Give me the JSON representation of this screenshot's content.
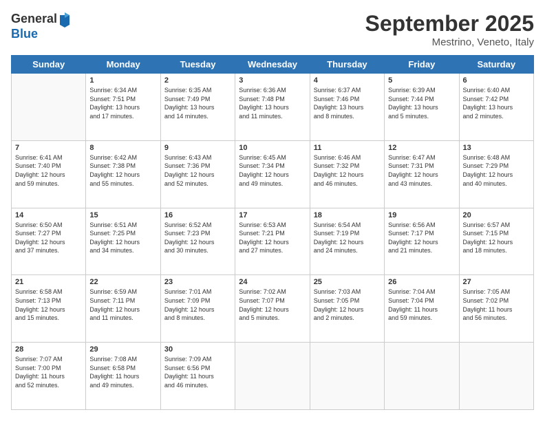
{
  "logo": {
    "general": "General",
    "blue": "Blue"
  },
  "header": {
    "month": "September 2025",
    "location": "Mestrino, Veneto, Italy"
  },
  "days_of_week": [
    "Sunday",
    "Monday",
    "Tuesday",
    "Wednesday",
    "Thursday",
    "Friday",
    "Saturday"
  ],
  "weeks": [
    [
      {
        "day": "",
        "content": ""
      },
      {
        "day": "1",
        "content": "Sunrise: 6:34 AM\nSunset: 7:51 PM\nDaylight: 13 hours\nand 17 minutes."
      },
      {
        "day": "2",
        "content": "Sunrise: 6:35 AM\nSunset: 7:49 PM\nDaylight: 13 hours\nand 14 minutes."
      },
      {
        "day": "3",
        "content": "Sunrise: 6:36 AM\nSunset: 7:48 PM\nDaylight: 13 hours\nand 11 minutes."
      },
      {
        "day": "4",
        "content": "Sunrise: 6:37 AM\nSunset: 7:46 PM\nDaylight: 13 hours\nand 8 minutes."
      },
      {
        "day": "5",
        "content": "Sunrise: 6:39 AM\nSunset: 7:44 PM\nDaylight: 13 hours\nand 5 minutes."
      },
      {
        "day": "6",
        "content": "Sunrise: 6:40 AM\nSunset: 7:42 PM\nDaylight: 13 hours\nand 2 minutes."
      }
    ],
    [
      {
        "day": "7",
        "content": "Sunrise: 6:41 AM\nSunset: 7:40 PM\nDaylight: 12 hours\nand 59 minutes."
      },
      {
        "day": "8",
        "content": "Sunrise: 6:42 AM\nSunset: 7:38 PM\nDaylight: 12 hours\nand 55 minutes."
      },
      {
        "day": "9",
        "content": "Sunrise: 6:43 AM\nSunset: 7:36 PM\nDaylight: 12 hours\nand 52 minutes."
      },
      {
        "day": "10",
        "content": "Sunrise: 6:45 AM\nSunset: 7:34 PM\nDaylight: 12 hours\nand 49 minutes."
      },
      {
        "day": "11",
        "content": "Sunrise: 6:46 AM\nSunset: 7:32 PM\nDaylight: 12 hours\nand 46 minutes."
      },
      {
        "day": "12",
        "content": "Sunrise: 6:47 AM\nSunset: 7:31 PM\nDaylight: 12 hours\nand 43 minutes."
      },
      {
        "day": "13",
        "content": "Sunrise: 6:48 AM\nSunset: 7:29 PM\nDaylight: 12 hours\nand 40 minutes."
      }
    ],
    [
      {
        "day": "14",
        "content": "Sunrise: 6:50 AM\nSunset: 7:27 PM\nDaylight: 12 hours\nand 37 minutes."
      },
      {
        "day": "15",
        "content": "Sunrise: 6:51 AM\nSunset: 7:25 PM\nDaylight: 12 hours\nand 34 minutes."
      },
      {
        "day": "16",
        "content": "Sunrise: 6:52 AM\nSunset: 7:23 PM\nDaylight: 12 hours\nand 30 minutes."
      },
      {
        "day": "17",
        "content": "Sunrise: 6:53 AM\nSunset: 7:21 PM\nDaylight: 12 hours\nand 27 minutes."
      },
      {
        "day": "18",
        "content": "Sunrise: 6:54 AM\nSunset: 7:19 PM\nDaylight: 12 hours\nand 24 minutes."
      },
      {
        "day": "19",
        "content": "Sunrise: 6:56 AM\nSunset: 7:17 PM\nDaylight: 12 hours\nand 21 minutes."
      },
      {
        "day": "20",
        "content": "Sunrise: 6:57 AM\nSunset: 7:15 PM\nDaylight: 12 hours\nand 18 minutes."
      }
    ],
    [
      {
        "day": "21",
        "content": "Sunrise: 6:58 AM\nSunset: 7:13 PM\nDaylight: 12 hours\nand 15 minutes."
      },
      {
        "day": "22",
        "content": "Sunrise: 6:59 AM\nSunset: 7:11 PM\nDaylight: 12 hours\nand 11 minutes."
      },
      {
        "day": "23",
        "content": "Sunrise: 7:01 AM\nSunset: 7:09 PM\nDaylight: 12 hours\nand 8 minutes."
      },
      {
        "day": "24",
        "content": "Sunrise: 7:02 AM\nSunset: 7:07 PM\nDaylight: 12 hours\nand 5 minutes."
      },
      {
        "day": "25",
        "content": "Sunrise: 7:03 AM\nSunset: 7:05 PM\nDaylight: 12 hours\nand 2 minutes."
      },
      {
        "day": "26",
        "content": "Sunrise: 7:04 AM\nSunset: 7:04 PM\nDaylight: 11 hours\nand 59 minutes."
      },
      {
        "day": "27",
        "content": "Sunrise: 7:05 AM\nSunset: 7:02 PM\nDaylight: 11 hours\nand 56 minutes."
      }
    ],
    [
      {
        "day": "28",
        "content": "Sunrise: 7:07 AM\nSunset: 7:00 PM\nDaylight: 11 hours\nand 52 minutes."
      },
      {
        "day": "29",
        "content": "Sunrise: 7:08 AM\nSunset: 6:58 PM\nDaylight: 11 hours\nand 49 minutes."
      },
      {
        "day": "30",
        "content": "Sunrise: 7:09 AM\nSunset: 6:56 PM\nDaylight: 11 hours\nand 46 minutes."
      },
      {
        "day": "",
        "content": ""
      },
      {
        "day": "",
        "content": ""
      },
      {
        "day": "",
        "content": ""
      },
      {
        "day": "",
        "content": ""
      }
    ]
  ]
}
